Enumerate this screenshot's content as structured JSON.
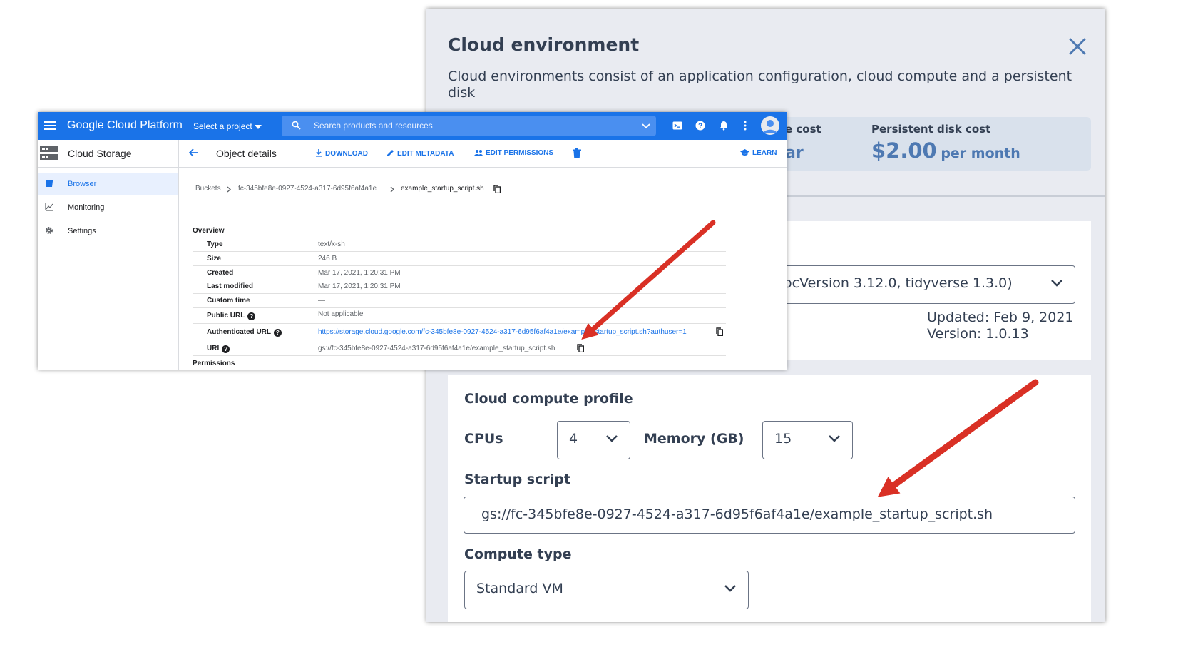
{
  "cloud_env": {
    "title": "Cloud environment",
    "description": "Cloud environments consist of an application configuration, cloud compute and a persistent disk",
    "running_cost": {
      "label_partial": "e cost",
      "value_partial": "ar"
    },
    "disk_cost": {
      "label": "Persistent disk cost",
      "value": "$2.00",
      "unit": "per month"
    },
    "application": {
      "selected_partial": "ocVersion 3.12.0, tidyverse 1.3.0)",
      "updated": "Updated: Feb 9, 2021",
      "version": "Version: 1.0.13"
    },
    "compute": {
      "title": "Cloud compute profile",
      "cpus_label": "CPUs",
      "cpus_value": "4",
      "memory_label": "Memory (GB)",
      "memory_value": "15",
      "startup_label": "Startup script",
      "startup_value": "gs://fc-345bfe8e-0927-4524-a317-6d95f6af4a1e/example_startup_script.sh",
      "compute_type_label": "Compute type",
      "compute_type_value": "Standard VM"
    }
  },
  "gcp": {
    "brand": "Google Cloud Platform",
    "project_selector": "Select a project",
    "search_placeholder": "Search products and resources",
    "sidebar": {
      "title": "Cloud Storage",
      "items": [
        {
          "label": "Browser",
          "icon": "bucket-icon",
          "active": true
        },
        {
          "label": "Monitoring",
          "icon": "chart-icon",
          "active": false
        },
        {
          "label": "Settings",
          "icon": "gear-icon",
          "active": false
        }
      ]
    },
    "header": {
      "title": "Object details",
      "actions": {
        "download": "DOWNLOAD",
        "edit_metadata": "EDIT METADATA",
        "edit_permissions": "EDIT PERMISSIONS",
        "learn": "LEARN"
      }
    },
    "breadcrumb": {
      "buckets": "Buckets",
      "bucket": "fc-345bfe8e-0927-4524-a317-6d95f6af4a1e",
      "object": "example_startup_script.sh"
    },
    "overview": {
      "title": "Overview",
      "rows": {
        "type": {
          "key": "Type",
          "value": "text/x-sh"
        },
        "size": {
          "key": "Size",
          "value": "246 B"
        },
        "created": {
          "key": "Created",
          "value": "Mar 17, 2021, 1:20:31 PM"
        },
        "last_modified": {
          "key": "Last modified",
          "value": "Mar 17, 2021, 1:20:31 PM"
        },
        "custom_time": {
          "key": "Custom time",
          "value": "—"
        },
        "public_url": {
          "key": "Public URL",
          "value": "Not applicable"
        },
        "authenticated_url": {
          "key": "Authenticated URL",
          "value": "https://storage.cloud.google.com/fc-345bfe8e-0927-4524-a317-6d95f6af4a1e/example_startup_script.sh?authuser=1"
        },
        "uri": {
          "key": "URI",
          "value": "gs://fc-345bfe8e-0927-4524-a317-6d95f6af4a1e/example_startup_script.sh"
        }
      }
    },
    "permissions_title": "Permissions"
  },
  "colors": {
    "gcp_blue": "#1a73e8",
    "panel_bg": "#e9ebf1",
    "cost_blue": "#4e79b2",
    "arrow_red": "#d93025"
  }
}
